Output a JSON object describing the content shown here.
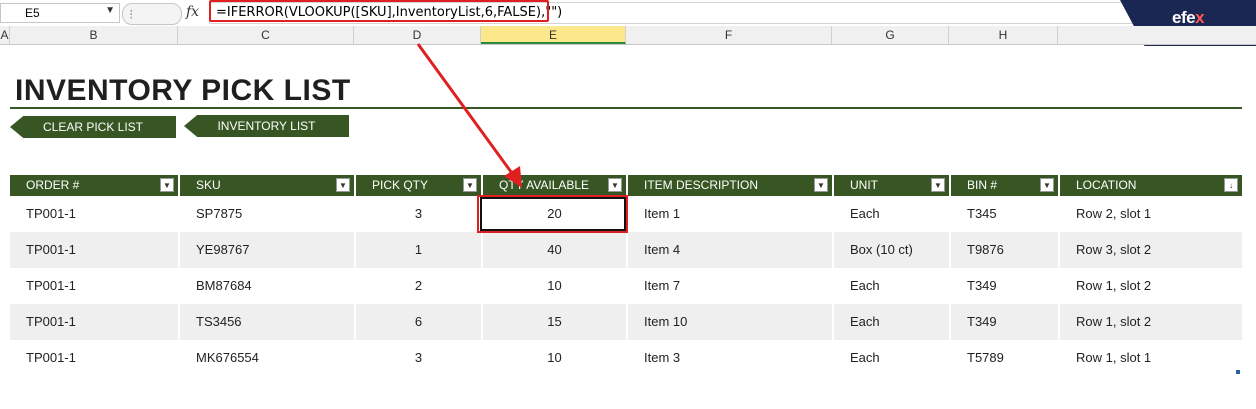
{
  "formula_bar": {
    "name_box": "E5",
    "fx_label": "fx",
    "formula": "=IFERROR(VLOOKUP([SKU],InventoryList,6,FALSE),\"\")"
  },
  "logo": {
    "text_main": "efe",
    "text_accent": "x"
  },
  "columns": [
    "A",
    "B",
    "C",
    "D",
    "E",
    "F",
    "G",
    "H"
  ],
  "title": "INVENTORY PICK LIST",
  "buttons": {
    "clear": "CLEAR PICK LIST",
    "inventory": "INVENTORY  LIST"
  },
  "table": {
    "headers": [
      "ORDER #",
      "SKU",
      "PICK QTY",
      "QTY AVAILABLE",
      "ITEM DESCRIPTION",
      "UNIT",
      "BIN #",
      "LOCATION"
    ],
    "rows": [
      [
        "TP001-1",
        "SP7875",
        "3",
        "20",
        "Item 1",
        "Each",
        "T345",
        "Row 2, slot 1"
      ],
      [
        "TP001-1",
        "YE98767",
        "1",
        "40",
        "Item 4",
        "Box (10 ct)",
        "T9876",
        "Row 3, slot 2"
      ],
      [
        "TP001-1",
        "BM87684",
        "2",
        "10",
        "Item 7",
        "Each",
        "T349",
        "Row 1, slot 2"
      ],
      [
        "TP001-1",
        "TS3456",
        "6",
        "15",
        "Item 10",
        "Each",
        "T349",
        "Row 1, slot 2"
      ],
      [
        "TP001-1",
        "MK676554",
        "3",
        "10",
        "Item 3",
        "Each",
        "T5789",
        "Row 1, slot 1"
      ]
    ]
  },
  "colors": {
    "header_green": "#375623",
    "highlight_red": "#e02020",
    "selected_col": "#fde78b",
    "logo_bg": "#1b2753"
  }
}
